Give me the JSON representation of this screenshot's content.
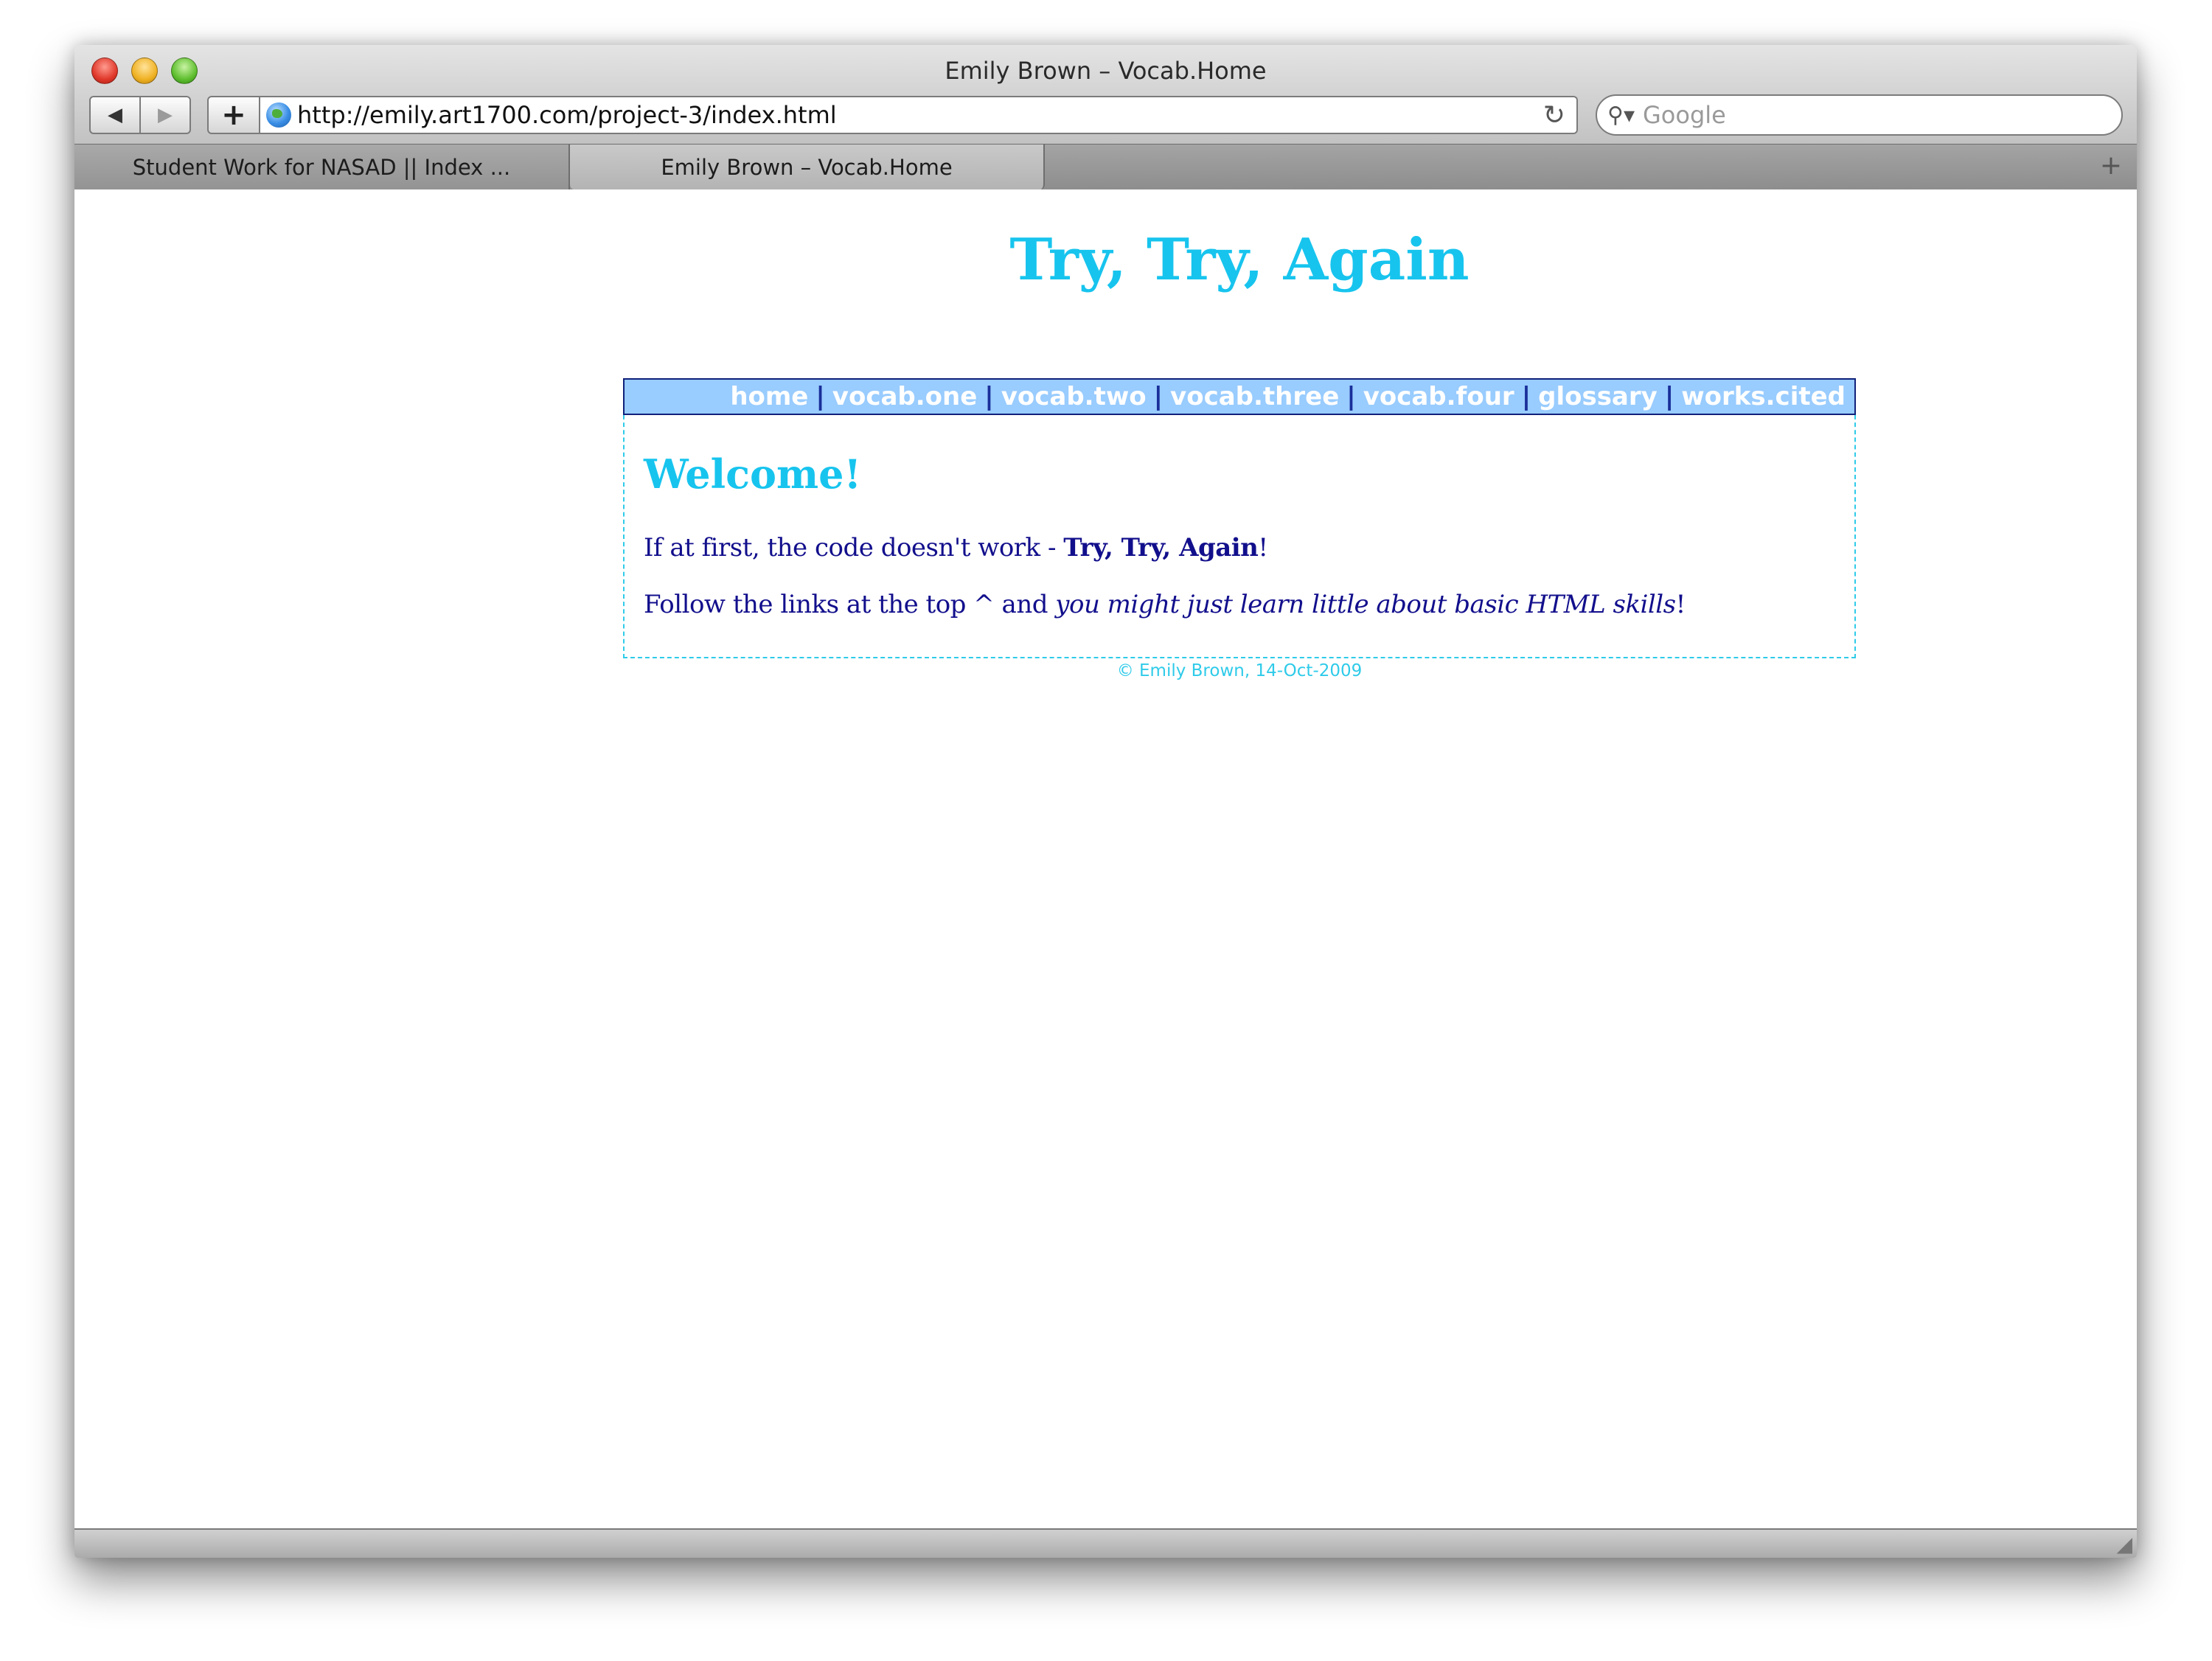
{
  "window": {
    "title": "Emily Brown – Vocab.Home"
  },
  "toolbar": {
    "back_glyph": "◀",
    "forward_glyph": "▶",
    "add_glyph": "+",
    "url": "http://emily.art1700.com/project-3/index.html",
    "reload_glyph": "↻",
    "search_placeholder": "Google",
    "search_glyph": "⚲▾"
  },
  "tabs": [
    {
      "label": "Student Work for NASAD || Index ..."
    },
    {
      "label": "Emily Brown – Vocab.Home"
    }
  ],
  "newtab_glyph": "+",
  "page": {
    "title": "Try, Try, Again",
    "nav": [
      "home",
      "vocab.one",
      "vocab.two",
      "vocab.three",
      "vocab.four",
      "glossary",
      "works.cited"
    ],
    "nav_separator": "|",
    "welcome": "Welcome!",
    "p1_text": "If at first, the code doesn't work - ",
    "p1_bold": "Try, Try, Again",
    "p1_end": "!",
    "p2_text": "Follow the links at the top ^ and ",
    "p2_italic": "you might just learn little about basic HTML skills",
    "p2_end": "!",
    "footer": "© Emily Brown, 14-Oct-2009"
  },
  "icons": {
    "close": "close-button-icon",
    "minimize": "minimize-button-icon",
    "zoom": "zoom-button-icon",
    "site": "globe-icon",
    "reload": "reload-icon",
    "search": "search-icon",
    "resize": "resize-grip-icon"
  },
  "colors": {
    "title": "#17c4ee",
    "nav_bg": "#99ccff",
    "nav_text": "#ffffff",
    "body_text": "#120f8c",
    "panel_border": "#2ecbe9"
  }
}
